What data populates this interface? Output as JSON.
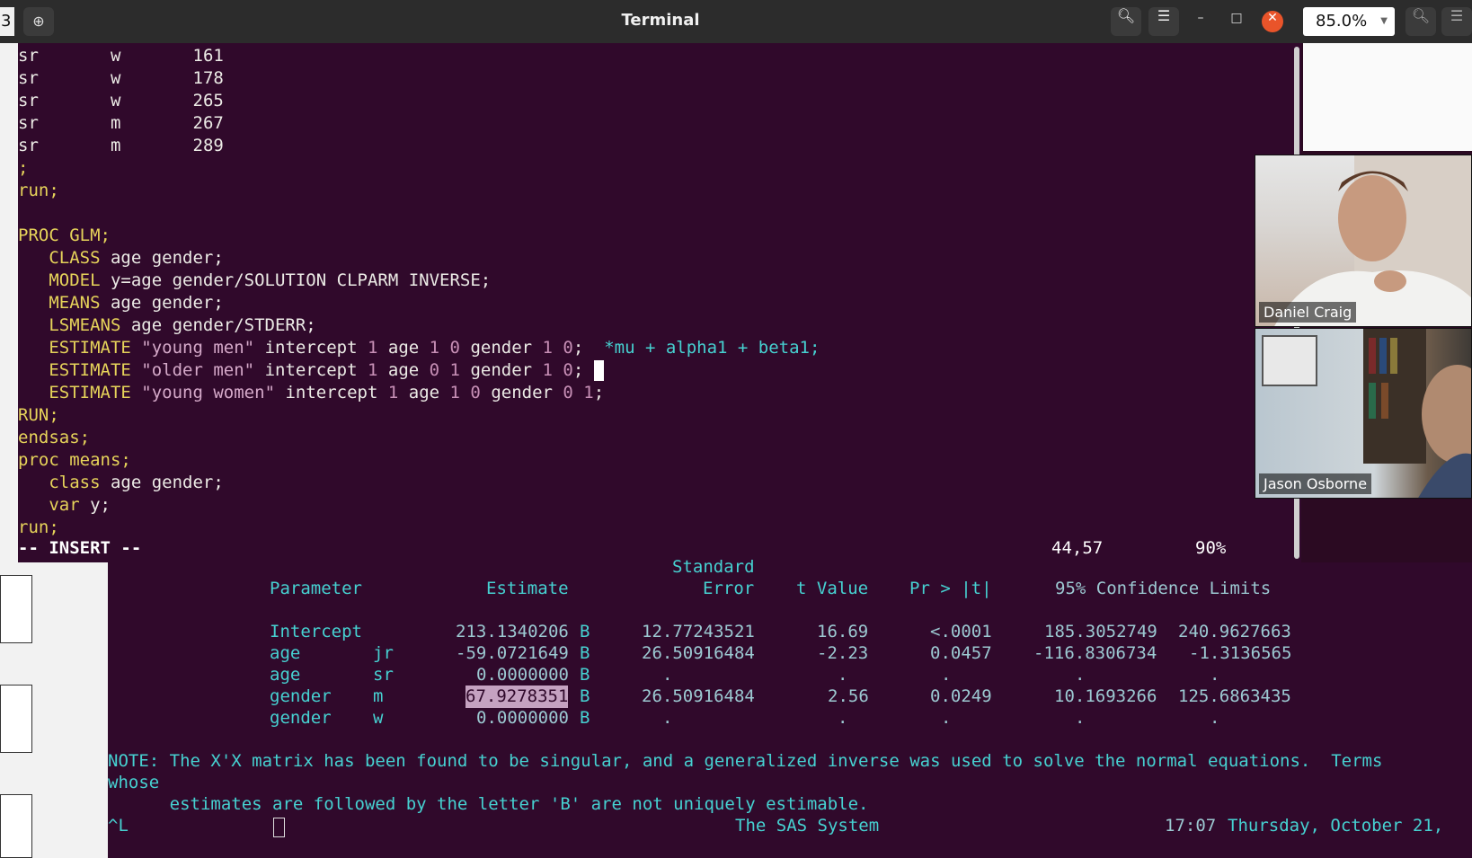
{
  "window": {
    "title": "Terminal",
    "tab_number": "3",
    "zoom": "85.0%"
  },
  "icons": {
    "new_tab": "new-tab-icon",
    "search": "search-icon",
    "menu": "hamburger-menu-icon",
    "minimize": "minimize-icon",
    "maximize": "maximize-icon",
    "close": "close-icon"
  },
  "vim": {
    "data_rows": [
      {
        "a": "sr",
        "b": "w",
        "c": "161"
      },
      {
        "a": "sr",
        "b": "w",
        "c": "178"
      },
      {
        "a": "sr",
        "b": "w",
        "c": "265"
      },
      {
        "a": "sr",
        "b": "m",
        "c": "267"
      },
      {
        "a": "sr",
        "b": "m",
        "c": "289"
      }
    ],
    "semicolon": ";",
    "run1": "run;",
    "proc_glm": "PROC GLM;",
    "class_kw": "CLASS",
    "class_rest": " age gender;",
    "model_kw": "MODEL",
    "model_rest": " y=age gender/SOLUTION CLPARM INVERSE;",
    "means_kw": "MEANS",
    "means_rest": " age gender;",
    "lsmeans_kw": "LSMEANS",
    "lsmeans_rest": " age gender/STDERR;",
    "estimate_kw": "ESTIMATE",
    "est1_label": "\"young men\"",
    "est1_comment": "*mu + alpha1 + beta1;",
    "est2_label": "\"older men\"",
    "est3_label": "\"young women\"",
    "kw_intercept": " intercept ",
    "kw_age": " age ",
    "kw_gender": " gender ",
    "n1": "1",
    "n0": "0",
    "semi_end": ";",
    "run_upper": "RUN;",
    "endsas": "endsas;",
    "proc_means": "proc means;",
    "class_lower_kw": "class",
    "class_lower_rest": " age gender;",
    "var_kw": "var",
    "var_rest": " y;",
    "run2": "run;",
    "mode": "-- INSERT --",
    "position": "44,57",
    "percent": "90%"
  },
  "participants": [
    {
      "name": "Daniel Craig"
    },
    {
      "name": "Jason Osborne"
    }
  ],
  "sas_output": {
    "header_standard": "Standard",
    "columns": [
      "Parameter",
      "Estimate",
      "Error",
      "t Value",
      "Pr > |t|",
      "95% Confidence Limits"
    ],
    "rows": [
      {
        "param": "Intercept",
        "level": "",
        "estimate": "213.1340206",
        "flag": "B",
        "stderr": "12.77243521",
        "t": "16.69",
        "p": "<.0001",
        "lcl": "185.3052749",
        "ucl": "240.9627663"
      },
      {
        "param": "age",
        "level": "jr",
        "estimate": "-59.0721649",
        "flag": "B",
        "stderr": "26.50916484",
        "t": "-2.23",
        "p": "0.0457",
        "lcl": "-116.8306734",
        "ucl": "-1.3136565"
      },
      {
        "param": "age",
        "level": "sr",
        "estimate": "0.0000000",
        "flag": "B",
        "stderr": ".",
        "t": ".",
        "p": ".",
        "lcl": ".",
        "ucl": "."
      },
      {
        "param": "gender",
        "level": "m",
        "estimate": "67.9278351",
        "flag": "B",
        "stderr": "26.50916484",
        "t": "2.56",
        "p": "0.0249",
        "lcl": "10.1693266",
        "ucl": "125.6863435"
      },
      {
        "param": "gender",
        "level": "w",
        "estimate": "0.0000000",
        "flag": "B",
        "stderr": ".",
        "t": ".",
        "p": ".",
        "lcl": ".",
        "ucl": "."
      }
    ],
    "note_line1": "NOTE: The X'X matrix has been found to be singular, and a generalized inverse was used to solve the normal equations.  Terms",
    "note_line2": "whose",
    "note_line3": "      estimates are followed by the letter 'B' are not uniquely estimable.",
    "ctrl": "^L",
    "system": "The SAS System",
    "time": "17:07",
    "date": "Thursday, October 21,"
  }
}
